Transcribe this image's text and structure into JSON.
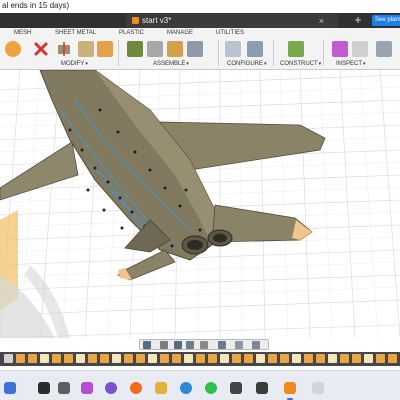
{
  "title_bar": {
    "text": "al ends in 15 days)"
  },
  "document_tab": {
    "name": "start v3*",
    "close": "×"
  },
  "new_tab": "+",
  "plans_button": "See plans",
  "workspace_tabs": [
    "MESH",
    "SHEET METAL",
    "PLASTIC",
    "MANAGE",
    "UTILITIES"
  ],
  "groups": {
    "modify": "MODIFY",
    "assemble": "ASSEMBLE",
    "configure": "CONFIGURE",
    "construct": "CONSTRUCT",
    "inspect": "INSPECT"
  },
  "dropdown_caret": "▾",
  "colors": {
    "accent_blue": "#1f7ee8",
    "model_body": "#8a8368",
    "wing_tip": "#f2c48a",
    "edge_blue": "#3a9be8",
    "origin_plane": "#f3c26a",
    "timeline_bg": "#474747",
    "taskbar_bg": "#e8ecf2"
  }
}
